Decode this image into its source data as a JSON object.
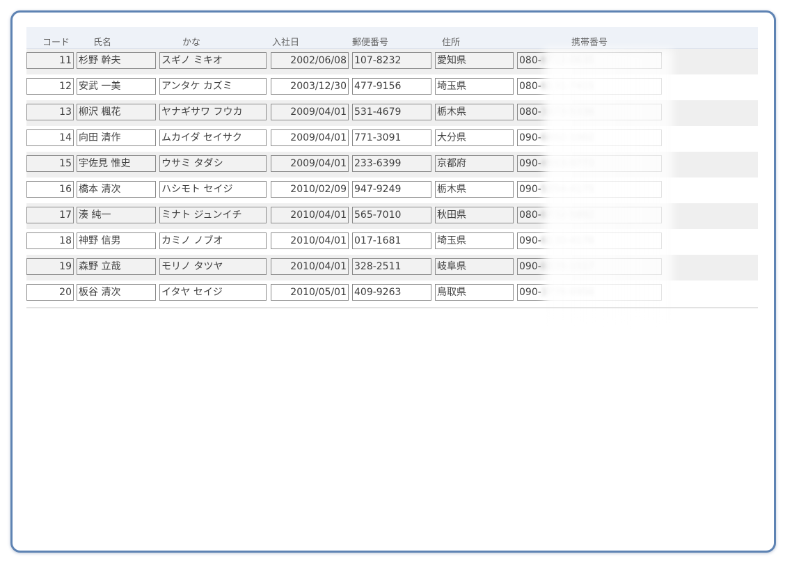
{
  "headers": {
    "code": "コード",
    "name": "氏名",
    "kana": "かな",
    "hire_date": "入社日",
    "postal": "郵便番号",
    "address": "住所",
    "mobile": "携帯番号"
  },
  "rows": [
    {
      "code": "11",
      "name": "杉野 幹夫",
      "kana": "スギノ ミキオ",
      "hire_date": "2002/06/08",
      "postal": "107-8232",
      "address": "愛知県",
      "mobile_prefix": "080-",
      "mobile_hidden": "6712-0635"
    },
    {
      "code": "12",
      "name": "安武 一美",
      "kana": "アンタケ カズミ",
      "hire_date": "2003/12/30",
      "postal": "477-9156",
      "address": "埼玉県",
      "mobile_prefix": "080-",
      "mobile_hidden": "6131-7415"
    },
    {
      "code": "13",
      "name": "柳沢 楓花",
      "kana": "ヤナギサワ フウカ",
      "hire_date": "2009/04/01",
      "postal": "531-4679",
      "address": "栃木県",
      "mobile_prefix": "080-",
      "mobile_hidden": "3373-5336"
    },
    {
      "code": "14",
      "name": "向田 清作",
      "kana": "ムカイダ セイサク",
      "hire_date": "2009/04/01",
      "postal": "771-3091",
      "address": "大分県",
      "mobile_prefix": "090-",
      "mobile_hidden": "6002-1002"
    },
    {
      "code": "15",
      "name": "宇佐見 惟史",
      "kana": "ウサミ タダシ",
      "hire_date": "2009/04/01",
      "postal": "233-6399",
      "address": "京都府",
      "mobile_prefix": "090-",
      "mobile_hidden": "4553-9773"
    },
    {
      "code": "16",
      "name": "橋本 清次",
      "kana": "ハシモト セイジ",
      "hire_date": "2010/02/09",
      "postal": "947-9249",
      "address": "栃木県",
      "mobile_prefix": "090-",
      "mobile_hidden": "5354-4175"
    },
    {
      "code": "17",
      "name": "湊 純一",
      "kana": "ミナト ジュンイチ",
      "hire_date": "2010/04/01",
      "postal": "565-7010",
      "address": "秋田県",
      "mobile_prefix": "080-",
      "mobile_hidden": "6732-5892"
    },
    {
      "code": "18",
      "name": "神野 信男",
      "kana": "カミノ ノブオ",
      "hire_date": "2010/04/01",
      "postal": "017-1681",
      "address": "埼玉県",
      "mobile_prefix": "090-",
      "mobile_hidden": "6130-4176"
    },
    {
      "code": "19",
      "name": "森野 立哉",
      "kana": "モリノ タツヤ",
      "hire_date": "2010/04/01",
      "postal": "328-2511",
      "address": "岐阜県",
      "mobile_prefix": "090-",
      "mobile_hidden": "6335-1517"
    },
    {
      "code": "20",
      "name": "板谷 清次",
      "kana": "イタヤ セイジ",
      "hire_date": "2010/05/01",
      "postal": "409-9263",
      "address": "鳥取県",
      "mobile_prefix": "090-",
      "mobile_hidden": "3776-6956"
    }
  ]
}
